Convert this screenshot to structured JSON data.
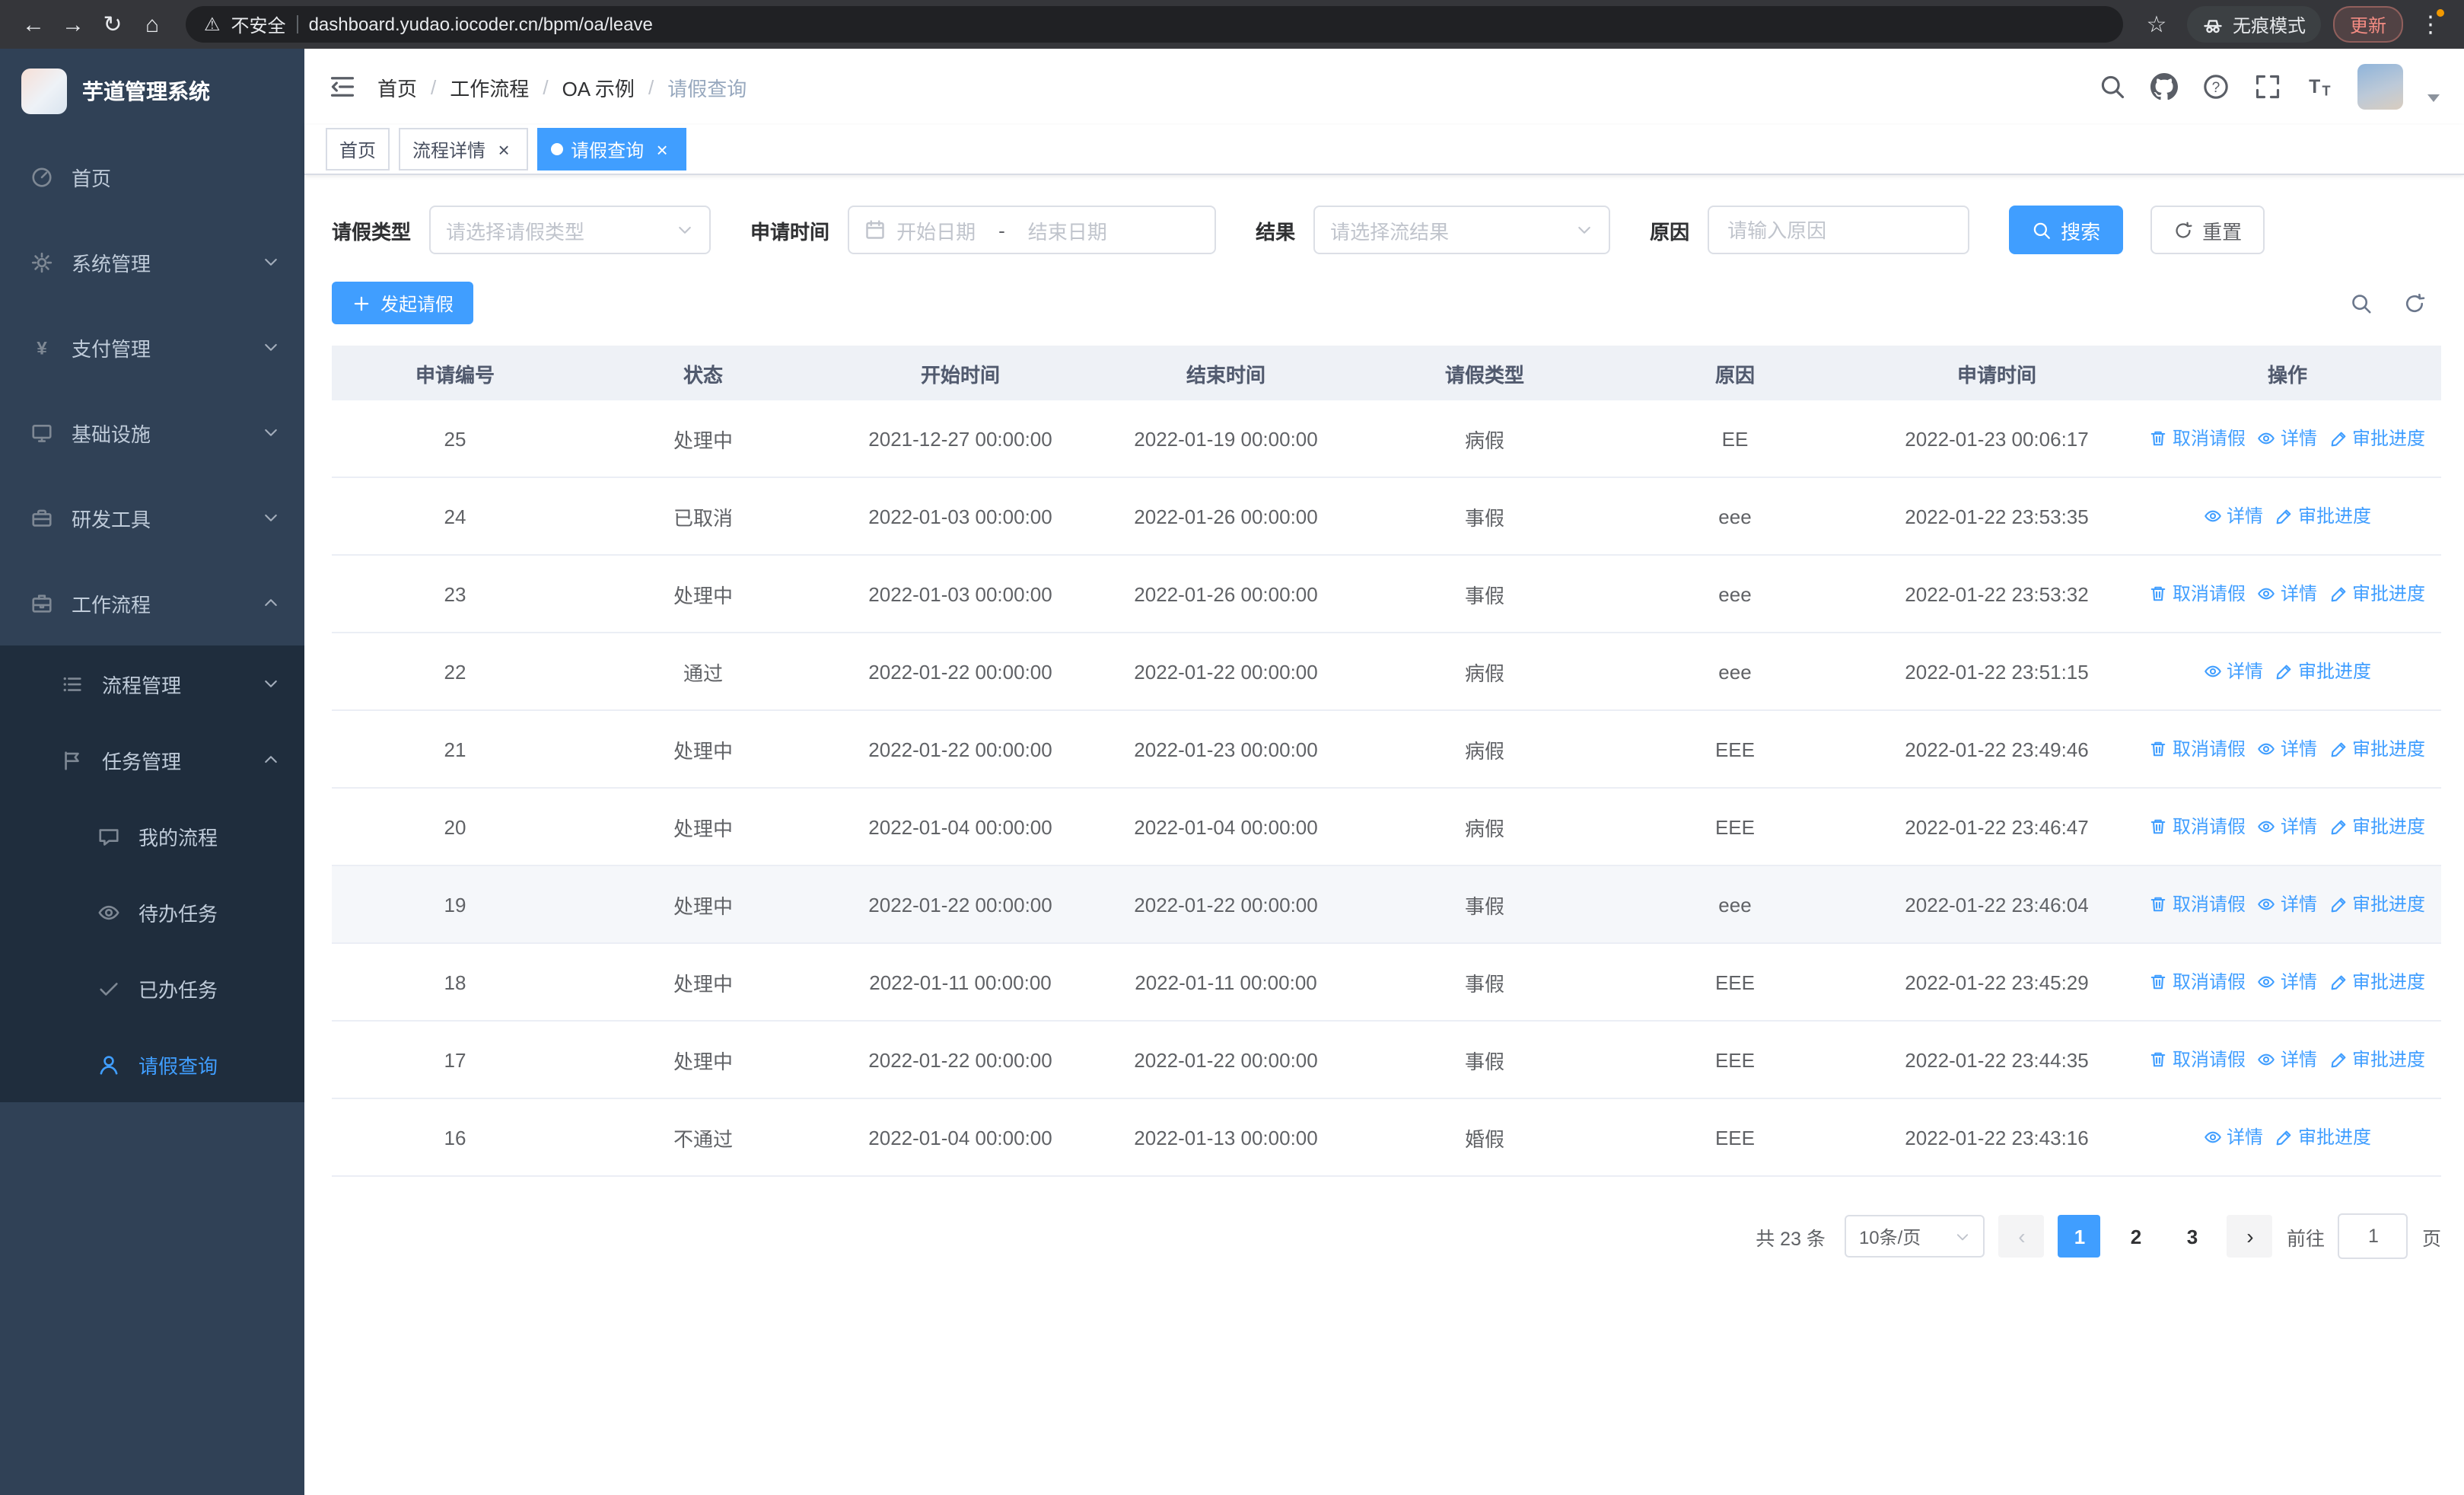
{
  "browser": {
    "url": "dashboard.yudao.iocoder.cn/bpm/oa/leave",
    "security_warning": "不安全",
    "incognito_label": "无痕模式",
    "update_label": "更新"
  },
  "sidebar": {
    "logo_title": "芋道管理系统",
    "items": [
      {
        "key": "home",
        "label": "首页",
        "icon": "gauge",
        "chevron": null
      },
      {
        "key": "system",
        "label": "系统管理",
        "icon": "gear",
        "chevron": "down"
      },
      {
        "key": "payment",
        "label": "支付管理",
        "icon": "yen",
        "chevron": "down"
      },
      {
        "key": "infra",
        "label": "基础设施",
        "icon": "monitor",
        "chevron": "down"
      },
      {
        "key": "devtools",
        "label": "研发工具",
        "icon": "toolbox",
        "chevron": "down"
      },
      {
        "key": "workflow",
        "label": "工作流程",
        "icon": "briefcase",
        "chevron": "up"
      }
    ],
    "sub_items": [
      {
        "key": "process-management",
        "label": "流程管理",
        "icon": "list",
        "chevron": "down",
        "level": 1
      },
      {
        "key": "task-management",
        "label": "任务管理",
        "icon": "flag",
        "chevron": "up",
        "level": 1
      },
      {
        "key": "my-process",
        "label": "我的流程",
        "icon": "chat",
        "level": 2
      },
      {
        "key": "todo-tasks",
        "label": "待办任务",
        "icon": "eye",
        "level": 2
      },
      {
        "key": "done-tasks",
        "label": "已办任务",
        "icon": "check",
        "level": 2
      },
      {
        "key": "leave-query",
        "label": "请假查询",
        "icon": "user",
        "level": 2,
        "active": true
      }
    ]
  },
  "header": {
    "breadcrumb": [
      "首页",
      "工作流程",
      "OA 示例",
      "请假查询"
    ]
  },
  "tabs": [
    {
      "key": "home",
      "label": "首页",
      "closable": false,
      "active": false
    },
    {
      "key": "process-detail",
      "label": "流程详情",
      "closable": true,
      "active": false
    },
    {
      "key": "leave-query",
      "label": "请假查询",
      "closable": true,
      "active": true
    }
  ],
  "filters": {
    "leave_type_label": "请假类型",
    "leave_type_placeholder": "请选择请假类型",
    "apply_time_label": "申请时间",
    "start_date_placeholder": "开始日期",
    "date_separator": "-",
    "end_date_placeholder": "结束日期",
    "result_label": "结果",
    "result_placeholder": "请选择流结果",
    "reason_label": "原因",
    "reason_placeholder": "请输入原因",
    "search_label": "搜索",
    "reset_label": "重置"
  },
  "toolbar": {
    "create_label": "发起请假"
  },
  "table": {
    "columns": [
      "申请编号",
      "状态",
      "开始时间",
      "结束时间",
      "请假类型",
      "原因",
      "申请时间",
      "操作"
    ],
    "action_labels": {
      "cancel": "取消请假",
      "detail": "详情",
      "progress": "审批进度"
    },
    "rows": [
      {
        "id": "25",
        "status": "处理中",
        "start": "2021-12-27 00:00:00",
        "end": "2022-01-19 00:00:00",
        "type": "病假",
        "reason": "EE",
        "applied": "2022-01-23 00:06:17",
        "actions": [
          "cancel",
          "detail",
          "progress"
        ]
      },
      {
        "id": "24",
        "status": "已取消",
        "start": "2022-01-03 00:00:00",
        "end": "2022-01-26 00:00:00",
        "type": "事假",
        "reason": "eee",
        "applied": "2022-01-22 23:53:35",
        "actions": [
          "detail",
          "progress"
        ]
      },
      {
        "id": "23",
        "status": "处理中",
        "start": "2022-01-03 00:00:00",
        "end": "2022-01-26 00:00:00",
        "type": "事假",
        "reason": "eee",
        "applied": "2022-01-22 23:53:32",
        "actions": [
          "cancel",
          "detail",
          "progress"
        ]
      },
      {
        "id": "22",
        "status": "通过",
        "start": "2022-01-22 00:00:00",
        "end": "2022-01-22 00:00:00",
        "type": "病假",
        "reason": "eee",
        "applied": "2022-01-22 23:51:15",
        "actions": [
          "detail",
          "progress"
        ]
      },
      {
        "id": "21",
        "status": "处理中",
        "start": "2022-01-22 00:00:00",
        "end": "2022-01-23 00:00:00",
        "type": "病假",
        "reason": "EEE",
        "applied": "2022-01-22 23:49:46",
        "actions": [
          "cancel",
          "detail",
          "progress"
        ]
      },
      {
        "id": "20",
        "status": "处理中",
        "start": "2022-01-04 00:00:00",
        "end": "2022-01-04 00:00:00",
        "type": "病假",
        "reason": "EEE",
        "applied": "2022-01-22 23:46:47",
        "actions": [
          "cancel",
          "detail",
          "progress"
        ]
      },
      {
        "id": "19",
        "status": "处理中",
        "start": "2022-01-22 00:00:00",
        "end": "2022-01-22 00:00:00",
        "type": "事假",
        "reason": "eee",
        "applied": "2022-01-22 23:46:04",
        "actions": [
          "cancel",
          "detail",
          "progress"
        ],
        "highlight": true
      },
      {
        "id": "18",
        "status": "处理中",
        "start": "2022-01-11 00:00:00",
        "end": "2022-01-11 00:00:00",
        "type": "事假",
        "reason": "EEE",
        "applied": "2022-01-22 23:45:29",
        "actions": [
          "cancel",
          "detail",
          "progress"
        ]
      },
      {
        "id": "17",
        "status": "处理中",
        "start": "2022-01-22 00:00:00",
        "end": "2022-01-22 00:00:00",
        "type": "事假",
        "reason": "EEE",
        "applied": "2022-01-22 23:44:35",
        "actions": [
          "cancel",
          "detail",
          "progress"
        ]
      },
      {
        "id": "16",
        "status": "不通过",
        "start": "2022-01-04 00:00:00",
        "end": "2022-01-13 00:00:00",
        "type": "婚假",
        "reason": "EEE",
        "applied": "2022-01-22 23:43:16",
        "actions": [
          "detail",
          "progress"
        ]
      }
    ]
  },
  "pagination": {
    "total_label": "共 23 条",
    "page_size": "10条/页",
    "pages": [
      "1",
      "2",
      "3"
    ],
    "active_page": "1",
    "goto_label": "前往",
    "goto_value": "1",
    "page_suffix": "页"
  },
  "colors": {
    "accent": "#409eff",
    "sidebar_bg": "#304156",
    "submenu_bg": "#1f2d3d",
    "danger_update": "#f28b82"
  }
}
